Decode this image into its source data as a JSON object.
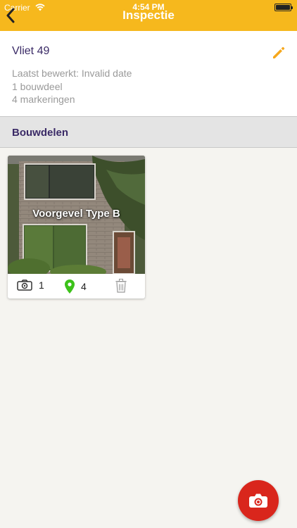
{
  "status_bar": {
    "carrier": "Carrier",
    "time": "4:54 PM",
    "battery_level": 1.0
  },
  "nav": {
    "title": "Inspectie",
    "back_icon": "chevron-left-icon"
  },
  "colors": {
    "accent": "#f6b81d",
    "title_purple": "#3a2a66",
    "fab_red": "#d9261c",
    "marker_green": "#3cc21a",
    "edit_orange": "#f6a81d"
  },
  "inspection": {
    "title": "Vliet 49",
    "last_edited": "Laatst bewerkt: Invalid date",
    "parts_count": "1 bouwdeel",
    "markers_count": "4 markeringen",
    "edit_icon": "pencil-icon"
  },
  "section": {
    "title": "Bouwdelen"
  },
  "parts": [
    {
      "name": "Voorgevel Type B",
      "photo_count": "1",
      "marker_count": "4",
      "icons": [
        "camera-icon",
        "map-pin-icon",
        "trash-icon"
      ]
    }
  ],
  "fab": {
    "icon": "camera-icon"
  }
}
